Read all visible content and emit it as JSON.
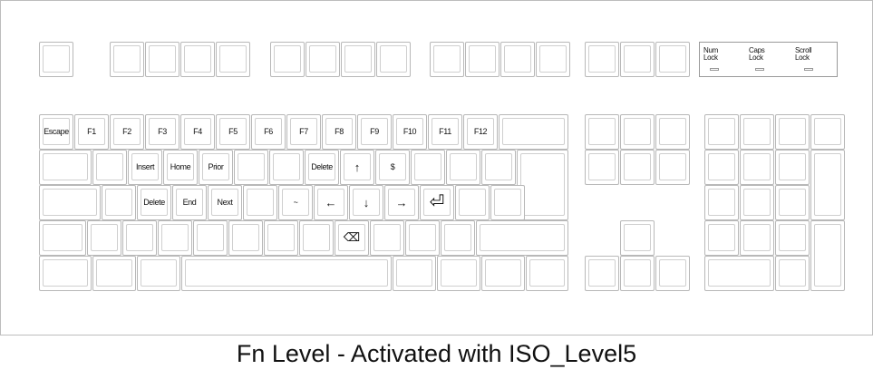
{
  "caption": "Fn Level - Activated with ISO_Level5",
  "indicators": {
    "num_lock": "Num\nLock",
    "caps_lock": "Caps\nLock",
    "scroll_lock": "Scroll\nLock"
  },
  "labels": {
    "escape": "Escape",
    "f1": "F1",
    "f2": "F2",
    "f3": "F3",
    "f4": "F4",
    "f5": "F5",
    "f6": "F6",
    "f7": "F7",
    "f8": "F8",
    "f9": "F9",
    "f10": "F10",
    "f11": "F11",
    "f12": "F12",
    "insert": "Insert",
    "home": "Home",
    "prior": "Prior",
    "delete_top": "Delete",
    "up_arrow": "↑",
    "dollar": "$",
    "delete_home": "Delete",
    "end": "End",
    "next": "Next",
    "tilde": "~",
    "left_arrow": "←",
    "down_arrow": "↓",
    "right_arrow": "→",
    "return": "⏎",
    "backspace": "⌫"
  }
}
